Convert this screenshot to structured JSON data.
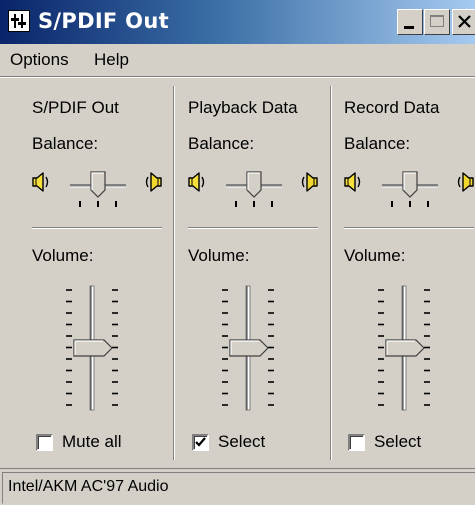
{
  "window": {
    "title": "S/PDIF Out"
  },
  "menu": [
    {
      "label": "Options"
    },
    {
      "label": "Help"
    }
  ],
  "channels": [
    {
      "title": "S/PDIF Out",
      "balance_label": "Balance:",
      "volume_label": "Volume:",
      "checkbox_label": "Mute all",
      "checked": false,
      "balance_value": 0.5,
      "volume_value": 0.5
    },
    {
      "title": "Playback Data",
      "balance_label": "Balance:",
      "volume_label": "Volume:",
      "checkbox_label": "Select",
      "checked": true,
      "balance_value": 0.5,
      "volume_value": 0.5
    },
    {
      "title": "Record Data",
      "balance_label": "Balance:",
      "volume_label": "Volume:",
      "checkbox_label": "Select",
      "checked": false,
      "balance_value": 0.5,
      "volume_value": 0.5
    }
  ],
  "status": {
    "text": "Intel/AKM AC'97 Audio"
  },
  "icons": {
    "app": "mixer-app-icon",
    "speaker": "speaker-icon",
    "check": "check-icon"
  },
  "colors": {
    "title_start": "#0a246a",
    "title_end": "#a6caf0",
    "face": "#d4d0c8",
    "speaker_left": "#f7e03c",
    "speaker_right": "#f0d830"
  }
}
